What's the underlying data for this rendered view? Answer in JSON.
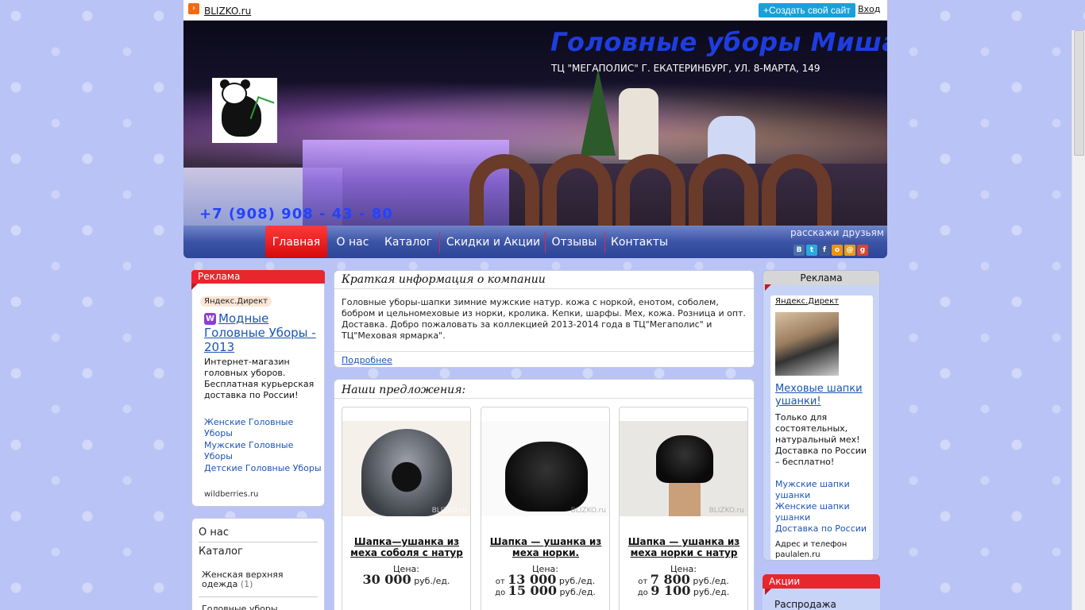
{
  "topbar": {
    "site_name": "BLIZKO.ru",
    "create_site": "+Создать свой сайт",
    "login": "Вход"
  },
  "header": {
    "title": "Головные уборы Мишан",
    "address": "ТЦ \"МЕГАПОЛИС\" Г. ЕКАТЕРИНБУРГ, УЛ. 8-МАРТА, 149",
    "phone": "+7 (908) 908 - 43 - 80"
  },
  "nav": {
    "items": [
      "Главная",
      "О нас",
      "Каталог",
      "Скидки и Акции",
      "Отзывы",
      "Контакты"
    ],
    "share_label": "расскажи друзьям",
    "share_icons": [
      "vk-icon",
      "twitter-icon",
      "facebook-icon",
      "odnoklassniki-icon",
      "mail-icon",
      "googleplus-icon"
    ]
  },
  "left_ad": {
    "header": "Реклама",
    "ydirect": "Яндекс.Директ",
    "title": "Модные Головные Уборы - 2013",
    "text": "Интернет-магазин головных уборов. Бесплатная курьерская доставка по России!",
    "links": [
      "Женские Головные Уборы",
      "Мужские Головные Уборы",
      "Детские Головные Уборы"
    ],
    "domain": "wildberries.ru"
  },
  "left_menu": {
    "about": "О нас",
    "catalog": "Каталог",
    "category1": "Женская верхняя одежда",
    "category1_count": "(1)",
    "category2": "Головные уборы"
  },
  "info": {
    "title": "Краткая информация о компании",
    "text": "Головные уборы-шапки зимние мужские натур. кожа с норкой, енотом, соболем, бобром и цельномеховые из норки, кролика. Кепки, шарфы. Мех, кожа. Розница и опт. Доставка. Добро пожаловать за коллекцией 2013-2014 года в ТЦ\"Мегаполис\" и ТЦ\"Меховая ярмарка\".",
    "more": "Подробнее"
  },
  "offers": {
    "title": "Наши предложения:",
    "price_label": "Цена:",
    "unit": "руб./ед.",
    "from": "от",
    "to": "до",
    "watermark": "BLIZKO.ru",
    "cards": [
      {
        "name": "Шапка—ушанка из меха соболя с натур",
        "price": "30 000"
      },
      {
        "name": "Шапка — ушанка из меха норки.",
        "price_from": "13 000",
        "price_to": "15 000"
      },
      {
        "name": "Шапка — ушанка из меха норки с натур",
        "price_from": "7 800",
        "price_to": "9 100"
      }
    ]
  },
  "right_ad": {
    "header": "Реклама",
    "ydirect": "Яндекс.Директ",
    "title": "Меховые шапки ушанки!",
    "text": "Только для состоятельных, натуральный мех! Доставка по России – бесплатно!",
    "links": [
      "Мужские шапки ушанки",
      "Женские шапки ушанки",
      "Доставка по России"
    ],
    "domain": "Адрес и телефон paulalen.ru"
  },
  "right_aktsii": {
    "header": "Акции",
    "item": "Распродажа"
  }
}
